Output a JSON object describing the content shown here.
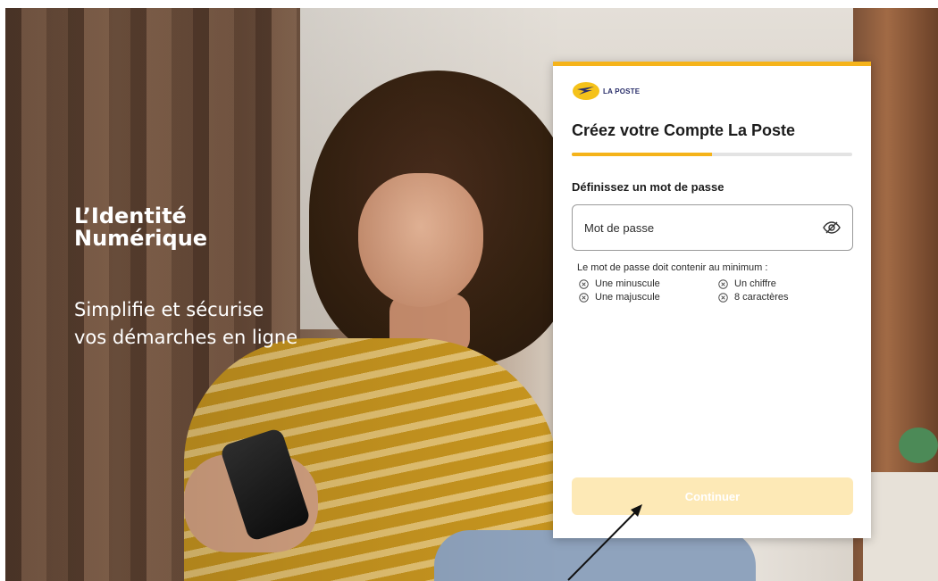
{
  "hero": {
    "title_line1": "L’Identité",
    "title_line2": "Numérique",
    "subtitle_line1": "Simplifie et sécurise",
    "subtitle_line2": "vos démarches en ligne"
  },
  "card": {
    "logo_text": "LA POSTE",
    "title": "Créez votre Compte La Poste",
    "progress_fraction": 0.5,
    "section_title": "Définissez un mot de passe",
    "password": {
      "placeholder": "Mot de passe",
      "value": ""
    },
    "rules_intro": "Le mot de passe doit contenir au minimum :",
    "rules": [
      {
        "label": "Une minuscule"
      },
      {
        "label": "Un chiffre"
      },
      {
        "label": "Une majuscule"
      },
      {
        "label": "8 caractères"
      }
    ],
    "continue_label": "Continuer"
  },
  "colors": {
    "accent": "#f5b31a",
    "button_disabled": "#fde9b6",
    "brand_navy": "#2a2f6b"
  },
  "icons": [
    "la-poste-logo-icon",
    "eye-slash-icon",
    "circle-x-icon",
    "annotation-arrow-icon"
  ]
}
